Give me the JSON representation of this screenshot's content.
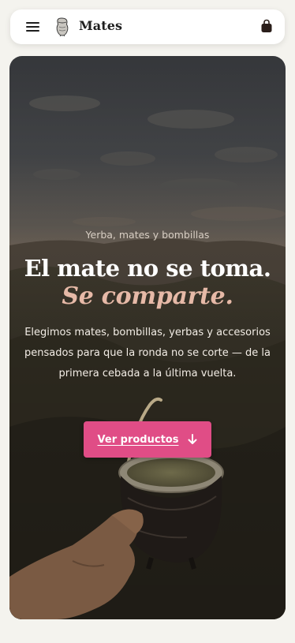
{
  "header": {
    "brand": "Mates",
    "menu_icon": "hamburger-menu-icon",
    "logo_icon": "mate-gourd-logo-icon",
    "cart_icon": "shopping-bag-icon"
  },
  "hero": {
    "eyebrow": "Yerba, mates y bombillas",
    "headline": "El mate no se toma.",
    "headline_accent": "Se comparte.",
    "description": "Elegimos mates, bombillas, yerbas y accesorios pensados para que la ronda no se corte — de la primera cebada a la última vuelta.",
    "cta_label": "Ver productos",
    "cta_icon": "arrow-down-icon",
    "background_image": "mountain-sunset-mate-photo"
  },
  "colors": {
    "page_bg": "#f4f3ee",
    "accent": "#e04d86",
    "accent_text": "#e6b9a7"
  }
}
